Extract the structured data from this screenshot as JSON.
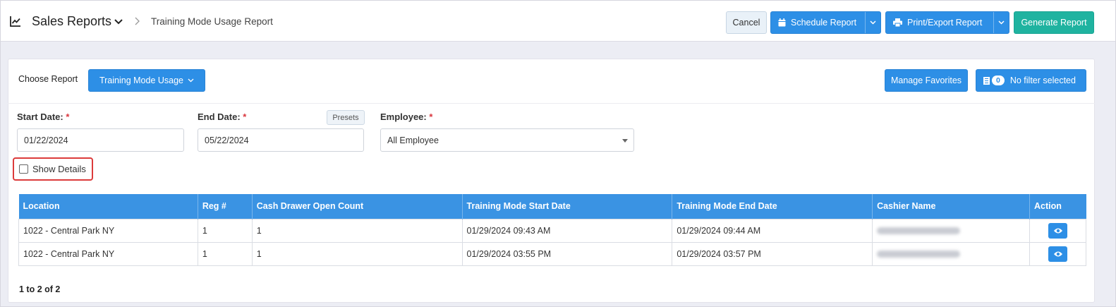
{
  "header": {
    "title": "Sales Reports",
    "breadcrumb": "Training Mode Usage Report",
    "buttons": {
      "cancel": "Cancel",
      "schedule": "Schedule Report",
      "print_export": "Print/Export Report",
      "generate": "Generate Report"
    }
  },
  "report_bar": {
    "choose_label": "Choose Report",
    "selected_report": "Training Mode Usage",
    "manage_favorites": "Manage Favorites",
    "filter_count": "0",
    "filter_text": "No filter selected"
  },
  "filters": {
    "start_date_label": "Start Date:",
    "start_date_value": "01/22/2024",
    "end_date_label": "End Date:",
    "end_date_value": "05/22/2024",
    "presets_label": "Presets",
    "employee_label": "Employee:",
    "employee_value": "All Employee",
    "required_mark": "*",
    "show_details_label": "Show Details",
    "show_details_checked": false
  },
  "table": {
    "columns": [
      "Location",
      "Reg #",
      "Cash Drawer Open Count",
      "Training Mode Start Date",
      "Training Mode End Date",
      "Cashier Name",
      "Action"
    ],
    "rows": [
      {
        "location": "1022 - Central Park NY",
        "reg": "1",
        "open_count": "1",
        "start": "01/29/2024 09:43 AM",
        "end": "01/29/2024 09:44 AM"
      },
      {
        "location": "1022 - Central Park NY",
        "reg": "1",
        "open_count": "1",
        "start": "01/29/2024 03:55 PM",
        "end": "01/29/2024 03:57 PM"
      }
    ],
    "pagination": "1 to 2 of 2"
  },
  "icons": {
    "title": "line-chart-icon",
    "schedule": "calendar-icon",
    "print": "printer-icon",
    "filter": "filter-list-icon",
    "action": "eye-icon"
  },
  "colors": {
    "primary": "#2d8fe6",
    "generate": "#1fb3a0",
    "table_header": "#3a93e3",
    "highlight_border": "#dc3b3b"
  }
}
